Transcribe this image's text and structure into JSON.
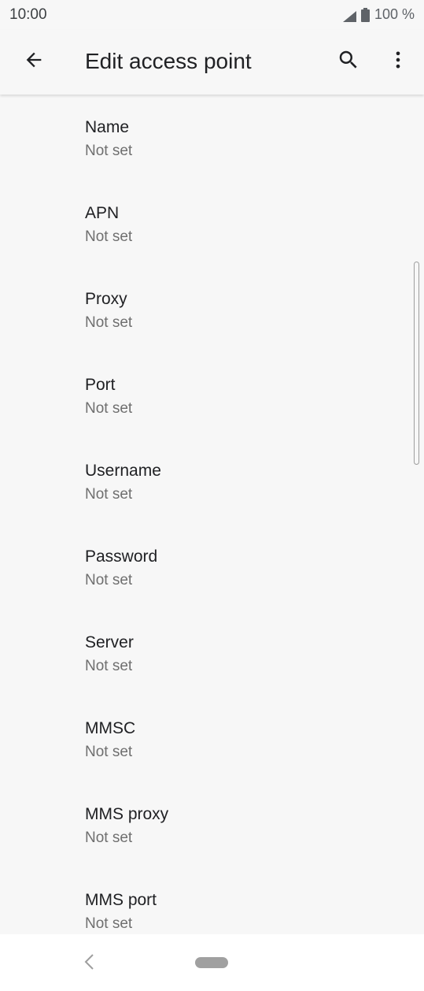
{
  "status_bar": {
    "time": "10:00",
    "battery_text": "100 %",
    "icons": [
      "signal-icon",
      "battery-icon"
    ]
  },
  "app_bar": {
    "title": "Edit access point",
    "icons": [
      "back-arrow-icon",
      "search-icon",
      "more-vert-icon"
    ]
  },
  "settings": {
    "items": [
      {
        "title": "Name",
        "summary": "Not set"
      },
      {
        "title": "APN",
        "summary": "Not set"
      },
      {
        "title": "Proxy",
        "summary": "Not set"
      },
      {
        "title": "Port",
        "summary": "Not set"
      },
      {
        "title": "Username",
        "summary": "Not set"
      },
      {
        "title": "Password",
        "summary": "Not set"
      },
      {
        "title": "Server",
        "summary": "Not set"
      },
      {
        "title": "MMSC",
        "summary": "Not set"
      },
      {
        "title": "MMS proxy",
        "summary": "Not set"
      },
      {
        "title": "MMS port",
        "summary": "Not set"
      }
    ]
  },
  "nav_bar": {
    "icons": [
      "nav-back-icon",
      "home-pill-icon"
    ]
  },
  "colors": {
    "background": "#f7f7f7",
    "title_text": "#202124",
    "summary_text": "#6f6f6f",
    "nav_bar": "#ffffff"
  }
}
